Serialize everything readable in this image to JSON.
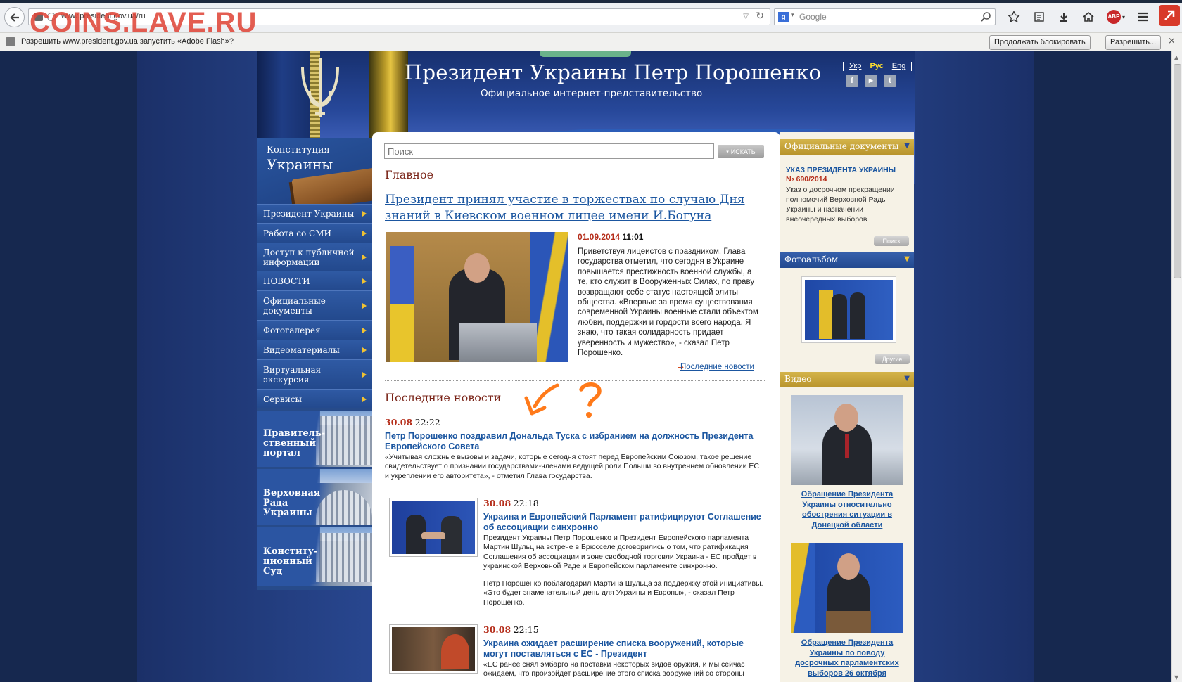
{
  "browser": {
    "url": "www.president.gov.ua/ru",
    "search_engine": "Google",
    "notification": "Разрешить www.president.gov.ua запустить «Adobe Flash»?",
    "btn_block": "Продолжать блокировать",
    "btn_allow": "Разрешить...",
    "close": "×",
    "abp": "ABP"
  },
  "watermark": "COINS.LAVE.RU",
  "header": {
    "title": "Президент Украины Петр Порошенко",
    "subtitle": "Официальное интернет-представительство",
    "langs": [
      "Укр",
      "Рус",
      "Eng"
    ],
    "active_lang": "Рус",
    "social": [
      "f",
      "▶",
      "t"
    ]
  },
  "sidebar": {
    "const_line1": "Конституция",
    "const_line2": "Украины",
    "items": [
      "Президент Украины",
      "Работа со СМИ",
      "Доступ к публичной информации",
      "НОВОСТИ",
      "Официальные документы",
      "Фотогалерея",
      "Видеоматериалы",
      "Виртуальная экскурсия",
      "Сервисы"
    ],
    "portals": [
      "Правитель-\nственный\nпортал",
      "Верховная\nРада\nУкраины",
      "Конститу-\nционный\nСуд"
    ]
  },
  "search": {
    "placeholder": "Поиск",
    "button": "ИСКАТЬ"
  },
  "main": {
    "section": "Главное",
    "headline": "Президент принял участие в торжествах по случаю Дня знаний в Киевском военном лицее имени И.Богуна",
    "date": "01.09.2014",
    "time": "11:01",
    "text": "Приветствуя лицеистов с праздником, Глава государства отметил, что сегодня в Украине повышается престижность военной службы, а те, кто служит в Вооруженных Силах, по праву возвращают себе статус настоящей элиты общества. «Впервые за время существования современной Украины военные стали объектом любви, поддержки и гордости всего народа. Я знаю, что такая солидарность придает уверенность и мужество», - сказал Петр Порошенко.",
    "latest_link": "Последние новости"
  },
  "latest": {
    "section": "Последние новости",
    "items": [
      {
        "date": "30.08",
        "time": "22:22",
        "title": "Петр Порошенко поздравил Дональда Туска с избранием на должность Президента Европейского Совета",
        "body": "«Учитывая сложные вызовы и задачи, которые сегодня стоят перед Европейским Союзом, такое решение свидетельствует о признании государствами-членами ведущей роли Польши во внутреннем обновлении ЕС и укреплении его авторитета», - отметил Глава государства."
      },
      {
        "date": "30.08",
        "time": "22:18",
        "title": "Украина и Европейский Парламент ратифицируют Соглашение об ассоциации синхронно",
        "body": "Президент Украины Петр Порошенко и Президент Европейского парламента Мартин Шульц на встрече в Брюсселе договорились о том, что ратификация Соглашения об ассоциации и зоне свободной торговли Украина - ЕС пройдет в украинской Верховной Раде и Европейском парламенте синхронно.",
        "body2": "Петр Порошенко поблагодарил Мартина Шульца за поддержку этой инициативы. «Это будет знаменательный день для Украины и Европы», - сказал Петр Порошенко."
      },
      {
        "date": "30.08",
        "time": "22:15",
        "title": "Украина ожидает расширение списка вооружений, которые могут поставляться с ЕС - Президент",
        "body": "«ЕС ранее снял эмбарго на поставки некоторых видов оружия, и мы сейчас ожидаем, что произойдет расширение этого списка вооружений со стороны"
      }
    ]
  },
  "right": {
    "docs_header": "Официальные документы",
    "doc_title": "УКАЗ ПРЕЗИДЕНТА УКРАИНЫ",
    "doc_number": "№ 690/2014",
    "doc_text": "Указ о досрочном прекращении полномочий Верховной Рады Украины и назначении внеочередных выборов",
    "doc_search": "Поиск",
    "photo_header": "Фотоальбом",
    "photo_other": "Другие",
    "video_header": "Видео",
    "video1": "Обращение Президента Украины относительно обострения ситуации в Донецкой области",
    "video2": "Обращение Президента Украины по поводу досрочных парламентских выборов 26 октября"
  },
  "colors": {
    "header_blue": "#2a4a95",
    "gold": "#d4b44a",
    "link": "#1b56a0",
    "date_red": "#b52d1a",
    "section_red": "#7a2418",
    "annotation_orange": "#ff7a1a"
  }
}
